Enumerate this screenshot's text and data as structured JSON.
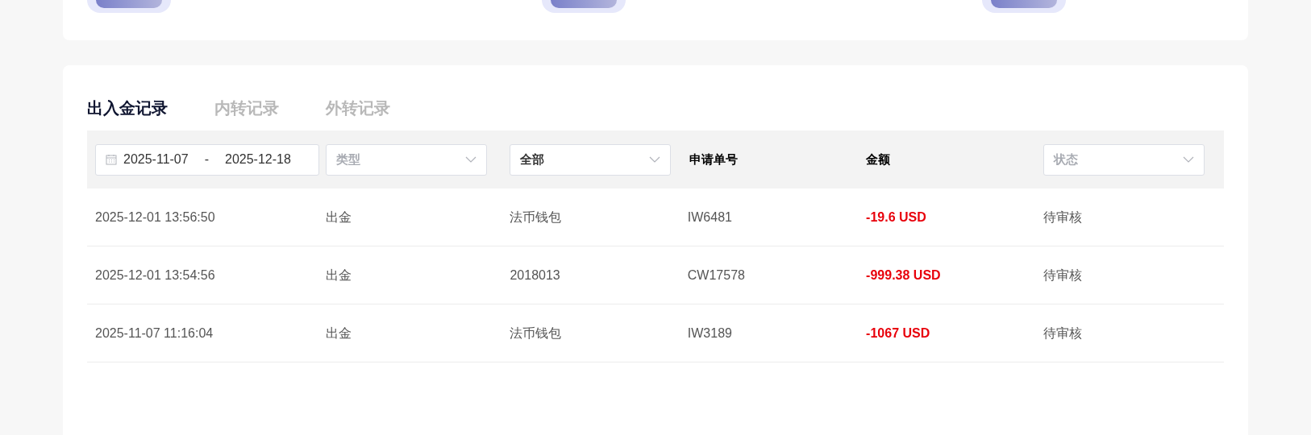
{
  "tabs": [
    {
      "label": "出入金记录",
      "selected": true
    },
    {
      "label": "内转记录",
      "selected": false
    },
    {
      "label": "外转记录",
      "selected": false
    }
  ],
  "filters": {
    "date_start": "2025-11-07",
    "date_separator": "-",
    "date_end": "2025-12-18",
    "type_placeholder": "类型",
    "wallet_value": "全部",
    "column_order_no": "申请单号",
    "column_amount": "金额",
    "status_placeholder": "状态"
  },
  "rows": [
    {
      "time": "2025-12-01 13:56:50",
      "type": "出金",
      "wallet": "法币钱包",
      "order_no": "IW6481",
      "amount": "-19.6 USD",
      "status": "待审核"
    },
    {
      "time": "2025-12-01 13:54:56",
      "type": "出金",
      "wallet": "2018013",
      "order_no": "CW17578",
      "amount": "-999.38 USD",
      "status": "待审核"
    },
    {
      "time": "2025-11-07 11:16:04",
      "type": "出金",
      "wallet": "法币钱包",
      "order_no": "IW3189",
      "amount": "-1067 USD",
      "status": "待审核"
    }
  ]
}
